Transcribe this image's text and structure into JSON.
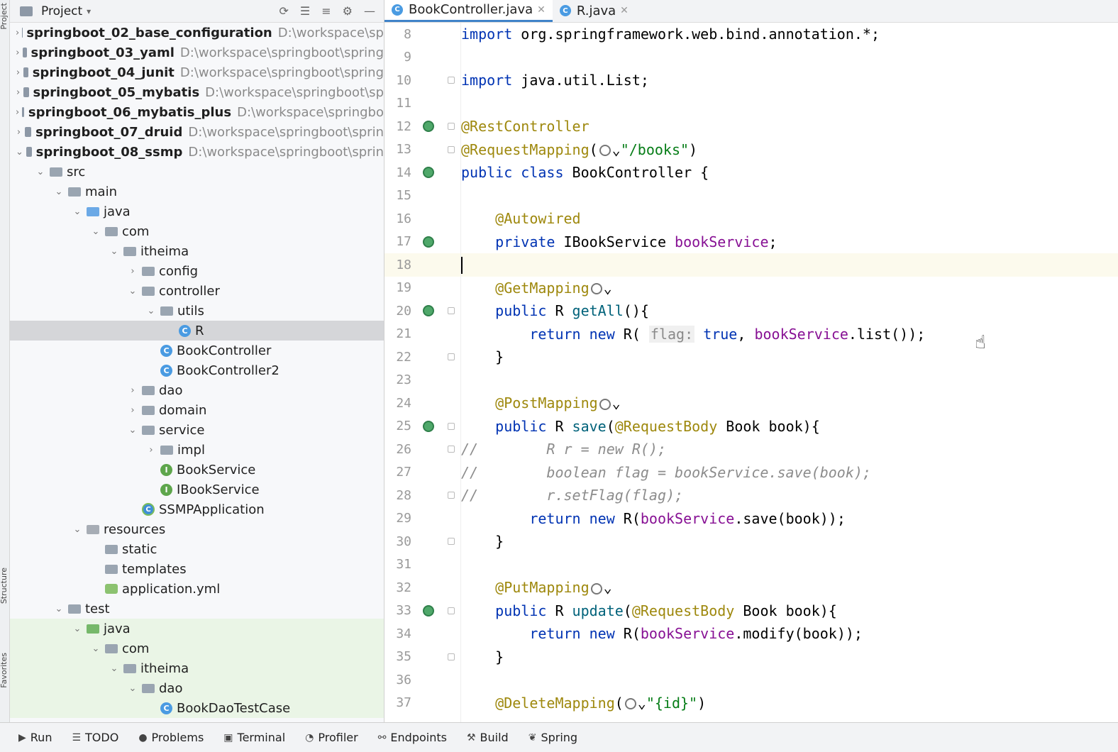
{
  "left_strip": {
    "top_label": "Project",
    "mid_label": "Structure",
    "bottom_label": "Favorites"
  },
  "project_panel": {
    "title": "Project",
    "tree": [
      {
        "level": 0,
        "chev": "›",
        "icon": "module",
        "name": "springboot_02_base_configuration",
        "path": "D:\\workspace\\sp",
        "bold": true
      },
      {
        "level": 0,
        "chev": "›",
        "icon": "module",
        "name": "springboot_03_yaml",
        "path": "D:\\workspace\\springboot\\spring",
        "bold": true
      },
      {
        "level": 0,
        "chev": "›",
        "icon": "module",
        "name": "springboot_04_junit",
        "path": "D:\\workspace\\springboot\\spring",
        "bold": true
      },
      {
        "level": 0,
        "chev": "›",
        "icon": "module",
        "name": "springboot_05_mybatis",
        "path": "D:\\workspace\\springboot\\sp",
        "bold": true
      },
      {
        "level": 0,
        "chev": "›",
        "icon": "module",
        "name": "springboot_06_mybatis_plus",
        "path": "D:\\workspace\\springbo",
        "bold": true
      },
      {
        "level": 0,
        "chev": "›",
        "icon": "module",
        "name": "springboot_07_druid",
        "path": "D:\\workspace\\springboot\\sprin",
        "bold": true
      },
      {
        "level": 0,
        "chev": "⌄",
        "icon": "module",
        "name": "springboot_08_ssmp",
        "path": "D:\\workspace\\springboot\\sprin",
        "bold": true
      },
      {
        "level": 1,
        "chev": "⌄",
        "icon": "folder",
        "name": "src"
      },
      {
        "level": 2,
        "chev": "⌄",
        "icon": "folder",
        "name": "main"
      },
      {
        "level": 3,
        "chev": "⌄",
        "icon": "folder-blue",
        "name": "java"
      },
      {
        "level": 4,
        "chev": "⌄",
        "icon": "folder",
        "name": "com"
      },
      {
        "level": 5,
        "chev": "⌄",
        "icon": "folder",
        "name": "itheima"
      },
      {
        "level": 6,
        "chev": "›",
        "icon": "folder",
        "name": "config"
      },
      {
        "level": 6,
        "chev": "⌄",
        "icon": "folder",
        "name": "controller"
      },
      {
        "level": 7,
        "chev": "⌄",
        "icon": "folder",
        "name": "utils"
      },
      {
        "level": 8,
        "chev": "",
        "icon": "class",
        "name": "R",
        "selected": true
      },
      {
        "level": 7,
        "chev": "",
        "icon": "class",
        "name": "BookController"
      },
      {
        "level": 7,
        "chev": "",
        "icon": "class",
        "name": "BookController2"
      },
      {
        "level": 6,
        "chev": "›",
        "icon": "folder",
        "name": "dao"
      },
      {
        "level": 6,
        "chev": "›",
        "icon": "folder",
        "name": "domain"
      },
      {
        "level": 6,
        "chev": "⌄",
        "icon": "folder",
        "name": "service"
      },
      {
        "level": 7,
        "chev": "›",
        "icon": "folder",
        "name": "impl"
      },
      {
        "level": 7,
        "chev": "",
        "icon": "interface",
        "name": "BookService"
      },
      {
        "level": 7,
        "chev": "",
        "icon": "interface",
        "name": "IBookService"
      },
      {
        "level": 6,
        "chev": "",
        "icon": "app",
        "name": "SSMPApplication"
      },
      {
        "level": 3,
        "chev": "⌄",
        "icon": "folder-res",
        "name": "resources"
      },
      {
        "level": 4,
        "chev": "",
        "icon": "folder",
        "name": "static"
      },
      {
        "level": 4,
        "chev": "",
        "icon": "folder",
        "name": "templates"
      },
      {
        "level": 4,
        "chev": "",
        "icon": "yml",
        "name": "application.yml"
      },
      {
        "level": 2,
        "chev": "⌄",
        "icon": "folder",
        "name": "test"
      },
      {
        "level": 3,
        "chev": "⌄",
        "icon": "folder-green",
        "name": "java",
        "test": true
      },
      {
        "level": 4,
        "chev": "⌄",
        "icon": "folder",
        "name": "com",
        "test": true
      },
      {
        "level": 5,
        "chev": "⌄",
        "icon": "folder",
        "name": "itheima",
        "test": true
      },
      {
        "level": 6,
        "chev": "⌄",
        "icon": "folder",
        "name": "dao",
        "test": true
      },
      {
        "level": 7,
        "chev": "",
        "icon": "class",
        "name": "BookDaoTestCase",
        "test": true
      }
    ]
  },
  "editor": {
    "tabs": [
      {
        "label": "BookController.java",
        "active": true
      },
      {
        "label": "R.java",
        "active": false
      }
    ],
    "lines": [
      {
        "n": "8",
        "html": "<span class=\"kw\">import</span> org.springframework.web.bind.annotation.*;"
      },
      {
        "n": "9",
        "html": ""
      },
      {
        "n": "10",
        "html": "<span class=\"kw\">import</span> java.util.List;",
        "fold": true
      },
      {
        "n": "11",
        "html": ""
      },
      {
        "n": "12",
        "html": "<span class=\"ann\">@RestController</span>",
        "bean": true,
        "fold": true
      },
      {
        "n": "13",
        "html": "<span class=\"ann\">@RequestMapping</span>(<span class=\"web-icon\"></span>⌄<span class=\"str\">\"/books\"</span>)",
        "fold": true
      },
      {
        "n": "14",
        "html": "<span class=\"kw\">public class</span> BookController {",
        "bean": true
      },
      {
        "n": "15",
        "html": ""
      },
      {
        "n": "16",
        "html": "    <span class=\"ann\">@Autowired</span>"
      },
      {
        "n": "17",
        "html": "    <span class=\"kw\">private</span> IBookService <span class=\"field\">bookService</span>;",
        "bean": true
      },
      {
        "n": "18",
        "html": "<span class=\"caret\"></span>",
        "current": true
      },
      {
        "n": "19",
        "html": "    <span class=\"ann\">@GetMapping</span><span class=\"web-icon\"></span>⌄"
      },
      {
        "n": "20",
        "html": "    <span class=\"kw\">public</span> R <span class=\"method\">getAll</span>(){",
        "bean": true,
        "fold": true
      },
      {
        "n": "21",
        "html": "        <span class=\"kw\">return new</span> R( <span class=\"hint\">flag:</span> <span class=\"kw\">true</span>, <span class=\"field\">bookService</span>.list());"
      },
      {
        "n": "22",
        "html": "    }",
        "fold": true
      },
      {
        "n": "23",
        "html": ""
      },
      {
        "n": "24",
        "html": "    <span class=\"ann\">@PostMapping</span><span class=\"web-icon\"></span>⌄"
      },
      {
        "n": "25",
        "html": "    <span class=\"kw\">public</span> R <span class=\"method\">save</span>(<span class=\"ann\">@RequestBody</span> Book book){",
        "bean": true,
        "fold": true
      },
      {
        "n": "26",
        "html": "<span class=\"cmt\">//        R r = new R();</span>",
        "fold": true
      },
      {
        "n": "27",
        "html": "<span class=\"cmt\">//        boolean flag = bookService.save(book);</span>"
      },
      {
        "n": "28",
        "html": "<span class=\"cmt\">//        r.setFlag(flag);</span>",
        "fold": true
      },
      {
        "n": "29",
        "html": "        <span class=\"kw\">return new</span> R(<span class=\"field\">bookService</span>.save(book));"
      },
      {
        "n": "30",
        "html": "    }",
        "fold": true
      },
      {
        "n": "31",
        "html": ""
      },
      {
        "n": "32",
        "html": "    <span class=\"ann\">@PutMapping</span><span class=\"web-icon\"></span>⌄"
      },
      {
        "n": "33",
        "html": "    <span class=\"kw\">public</span> R <span class=\"method\">update</span>(<span class=\"ann\">@RequestBody</span> Book book){",
        "bean": true,
        "fold": true
      },
      {
        "n": "34",
        "html": "        <span class=\"kw\">return new</span> R(<span class=\"field\">bookService</span>.modify(book));"
      },
      {
        "n": "35",
        "html": "    }",
        "fold": true
      },
      {
        "n": "36",
        "html": ""
      },
      {
        "n": "37",
        "html": "    <span class=\"ann\">@DeleteMapping</span>(<span class=\"web-icon\"></span>⌄<span class=\"str\">\"{id}\"</span>)"
      }
    ]
  },
  "bottom_bar": [
    {
      "icon": "▶",
      "label": "Run"
    },
    {
      "icon": "☰",
      "label": "TODO"
    },
    {
      "icon": "●",
      "label": "Problems"
    },
    {
      "icon": "▣",
      "label": "Terminal"
    },
    {
      "icon": "◔",
      "label": "Profiler"
    },
    {
      "icon": "⚯",
      "label": "Endpoints"
    },
    {
      "icon": "⚒",
      "label": "Build"
    },
    {
      "icon": "❦",
      "label": "Spring"
    }
  ]
}
